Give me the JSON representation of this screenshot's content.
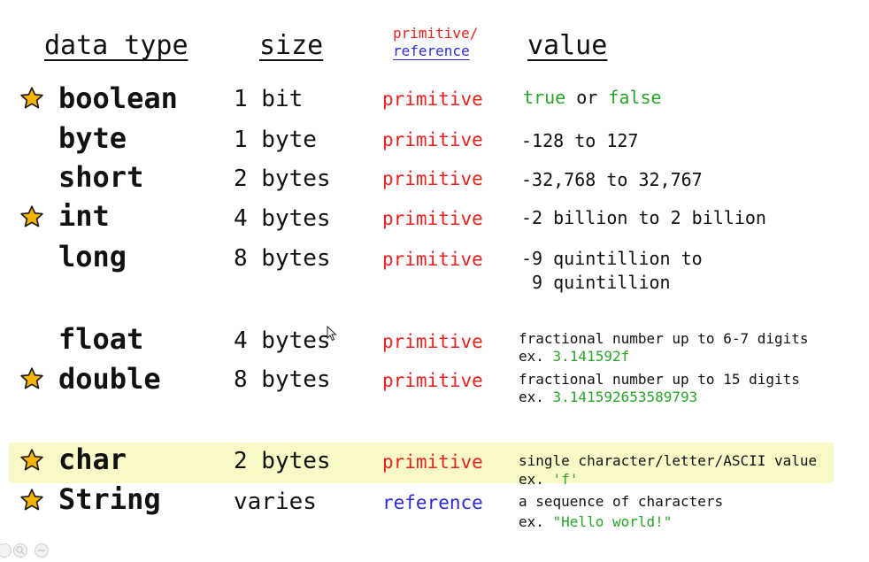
{
  "headers": {
    "data_type": "data type",
    "size": "size",
    "primitive": "primitive/",
    "reference": "reference",
    "value": "value"
  },
  "rows": [
    {
      "type": "boolean",
      "size": "1 bit",
      "kind": "primitive",
      "starred": true,
      "value_true": "true",
      "value_or": " or ",
      "value_false": "false"
    },
    {
      "type": "byte",
      "size": "1 byte",
      "kind": "primitive",
      "starred": false,
      "value": "-128 to 127"
    },
    {
      "type": "short",
      "size": "2 bytes",
      "kind": "primitive",
      "starred": false,
      "value": "-32,768 to 32,767"
    },
    {
      "type": "int",
      "size": "4 bytes",
      "kind": "primitive",
      "starred": true,
      "value": "-2 billion to 2 billion"
    },
    {
      "type": "long",
      "size": "8 bytes",
      "kind": "primitive",
      "starred": false,
      "value_line1": "-9 quintillion to",
      "value_line2": " 9 quintillion"
    },
    {
      "type": "float",
      "size": "4 bytes",
      "kind": "primitive",
      "starred": false,
      "value_line1": "fractional number up to 6-7 digits",
      "ex_prefix": "ex. ",
      "ex_value": "3.141592f"
    },
    {
      "type": "double",
      "size": "8 bytes",
      "kind": "primitive",
      "starred": true,
      "value_line1": "fractional number up to 15 digits",
      "ex_prefix": "ex. ",
      "ex_value": "3.141592653589793"
    },
    {
      "type": "char",
      "size": "2 bytes",
      "kind": "primitive",
      "starred": true,
      "highlighted": true,
      "value_line1": "single character/letter/ASCII value",
      "ex_prefix": "ex. ",
      "ex_value": "'f'"
    },
    {
      "type": "String",
      "size": "varies",
      "kind": "reference",
      "starred": true,
      "value_line1": "a sequence of characters",
      "ex_prefix": "ex. ",
      "ex_value": "\"Hello world!\""
    }
  ],
  "colors": {
    "primitive": "#e8231f",
    "reference": "#2b2bd6",
    "literal": "#2aa52a",
    "star_fill": "#f4b400",
    "highlight": "#fafac8"
  },
  "icons": {
    "star": "star-icon",
    "zoom_in": "zoom-in-icon",
    "zoom_out": "zoom-out-icon",
    "cursor": "mouse-cursor-icon"
  }
}
